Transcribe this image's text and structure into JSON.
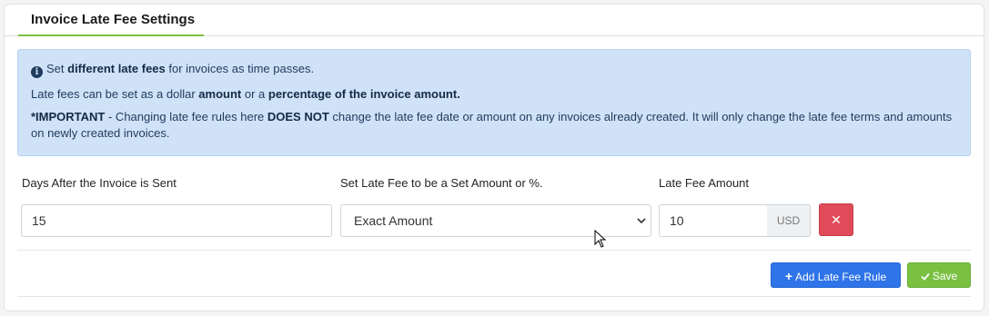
{
  "tab": {
    "label": "Invoice Late Fee Settings"
  },
  "alert": {
    "line1_pre": "Set ",
    "line1_bold": "different late fees",
    "line1_post": " for invoices as time passes.",
    "line2_pre": "Late fees can be set as a dollar ",
    "line2_bold1": "amount",
    "line2_mid": " or a ",
    "line2_bold2": "percentage of the invoice amount.",
    "line3_bold1": "*IMPORTANT",
    "line3_mid": " - Changing late fee rules here ",
    "line3_bold2": "DOES NOT",
    "line3_post": " change the late fee date or amount on any invoices already created. It will only change the late fee terms and amounts on newly created invoices."
  },
  "fields": {
    "days_label": "Days After the Invoice is Sent",
    "days_value": "15",
    "type_label": "Set Late Fee to be a Set Amount or %.",
    "type_value": "Exact Amount",
    "amount_label": "Late Fee Amount",
    "amount_value": "10",
    "amount_unit": "USD",
    "delete_glyph": "✕"
  },
  "buttons": {
    "add_label": "Add Late Fee Rule",
    "save_label": "Save"
  },
  "colors": {
    "tab_underline": "#7ac142",
    "alert_bg": "#cfe2f8",
    "delete_bg": "#e04b59",
    "add_bg": "#2f74e8",
    "save_bg": "#7ac142"
  }
}
